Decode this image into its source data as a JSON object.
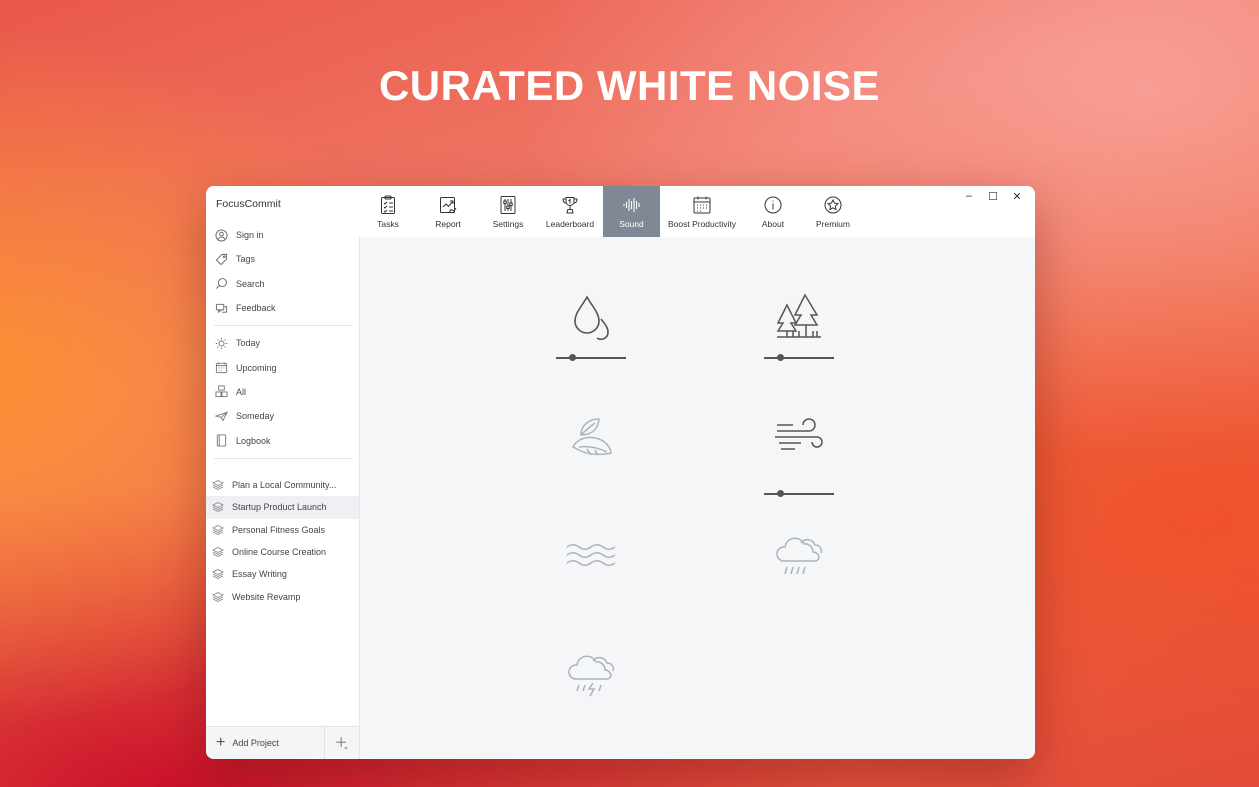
{
  "hero": {
    "title": "CURATED WHITE NOISE"
  },
  "app": {
    "name": "FocusCommit"
  },
  "sidebar": {
    "nav_top": [
      {
        "label": "Sign in",
        "icon": "user-circle-icon"
      },
      {
        "label": "Tags",
        "icon": "tag-icon"
      },
      {
        "label": "Search",
        "icon": "search-icon"
      },
      {
        "label": "Feedback",
        "icon": "feedback-icon"
      }
    ],
    "nav_views": [
      {
        "label": "Today",
        "icon": "sun-icon"
      },
      {
        "label": "Upcoming",
        "icon": "calendar-icon"
      },
      {
        "label": "All",
        "icon": "boxes-icon"
      },
      {
        "label": "Someday",
        "icon": "paper-plane-icon"
      },
      {
        "label": "Logbook",
        "icon": "book-icon"
      }
    ],
    "projects": [
      {
        "label": "Plan a Local Community...",
        "active": false
      },
      {
        "label": "Startup Product Launch",
        "active": true
      },
      {
        "label": "Personal Fitness Goals",
        "active": false
      },
      {
        "label": "Online Course Creation",
        "active": false
      },
      {
        "label": "Essay Writing",
        "active": false
      },
      {
        "label": "Website Revamp",
        "active": false
      }
    ],
    "add_project_label": "Add Project"
  },
  "toolbar": {
    "tabs": [
      {
        "label": "Tasks",
        "icon": "clipboard-checklist-icon",
        "active": false
      },
      {
        "label": "Report",
        "icon": "chart-report-icon",
        "active": false
      },
      {
        "label": "Settings",
        "icon": "sliders-icon",
        "active": false
      },
      {
        "label": "Leaderboard",
        "icon": "trophy-icon",
        "active": false
      },
      {
        "label": "Sound",
        "icon": "soundwave-icon",
        "active": true
      },
      {
        "label": "Boost Productivity",
        "icon": "calendar-grid-icon",
        "active": false
      },
      {
        "label": "About",
        "icon": "info-icon",
        "active": false
      },
      {
        "label": "Premium",
        "icon": "star-badge-icon",
        "active": false
      }
    ],
    "active_color": "#7f8894"
  },
  "window_controls": {
    "minimize": "–",
    "maximize": "☐",
    "close": "✕"
  },
  "sounds": [
    {
      "icon": "water-drops-icon",
      "active": true,
      "volume": 0.24
    },
    {
      "icon": "forest-icon",
      "active": true,
      "volume": 0.24
    },
    {
      "icon": "leaves-icon",
      "active": false
    },
    {
      "icon": "wind-icon",
      "active": true,
      "volume": 0.24
    },
    {
      "icon": "waves-icon",
      "active": false
    },
    {
      "icon": "rain-cloud-icon",
      "active": false
    },
    {
      "icon": "thunderstorm-icon",
      "active": false
    }
  ]
}
